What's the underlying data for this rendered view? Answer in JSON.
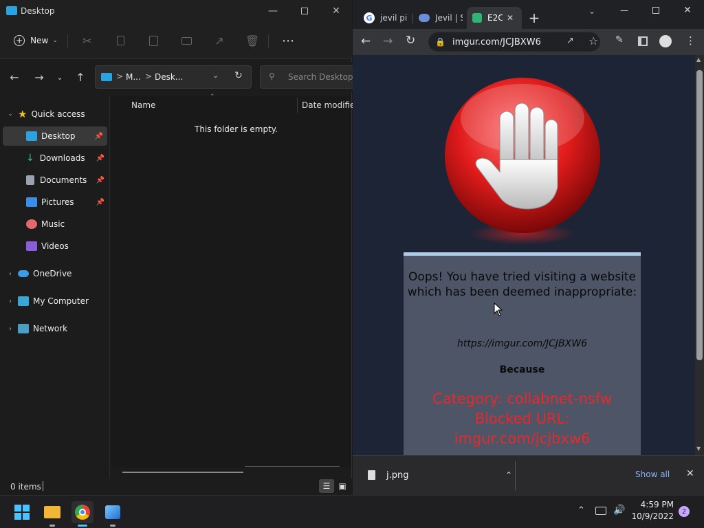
{
  "explorer": {
    "title": "Desktop",
    "toolbar": {
      "new_label": "New"
    },
    "address": {
      "part1": "M...",
      "part2": "Desk...",
      "separator": ">"
    },
    "search": {
      "placeholder": "Search Desktop"
    },
    "columns": {
      "name": "Name",
      "date_modified": "Date modified"
    },
    "empty_message": "This folder is empty.",
    "status": "0 items",
    "sidebar": {
      "quick_access": "Quick access",
      "items": [
        {
          "label": "Desktop",
          "icon": "desktop-icon",
          "pinned": true
        },
        {
          "label": "Downloads",
          "icon": "downloads-icon",
          "pinned": true
        },
        {
          "label": "Documents",
          "icon": "documents-icon",
          "pinned": true
        },
        {
          "label": "Pictures",
          "icon": "pictures-icon",
          "pinned": true
        },
        {
          "label": "Music",
          "icon": "music-icon",
          "pinned": false
        },
        {
          "label": "Videos",
          "icon": "videos-icon",
          "pinned": false
        }
      ],
      "onedrive": "OneDrive",
      "my_computer": "My Computer",
      "network": "Network"
    }
  },
  "chrome": {
    "tabs": [
      {
        "label": "jevil pi",
        "icon": "google-icon"
      },
      {
        "label": "Jevil | S",
        "icon": "site-icon"
      },
      {
        "label": "E2C",
        "icon": "shield-icon",
        "active": true
      }
    ],
    "url": "imgur.com/JCJBXW6",
    "block_page": {
      "message": "Oops! You have tried visiting a website which has been deemed inappropriate:",
      "blocked_url": "https://imgur.com/JCJBXW6",
      "because": "Because",
      "category": "Category: collabnet-nsfw",
      "blocked_url_label": "Blocked URL:",
      "blocked_url_value": "imgur.com/jcjbxw6"
    },
    "download": {
      "filename": "j.png",
      "show_all": "Show all"
    }
  },
  "taskbar": {
    "time": "4:59 PM",
    "date": "10/9/2022",
    "notification_count": "2"
  },
  "colors": {
    "accent": "#4cc2ff",
    "block_red": "#e8282b"
  }
}
